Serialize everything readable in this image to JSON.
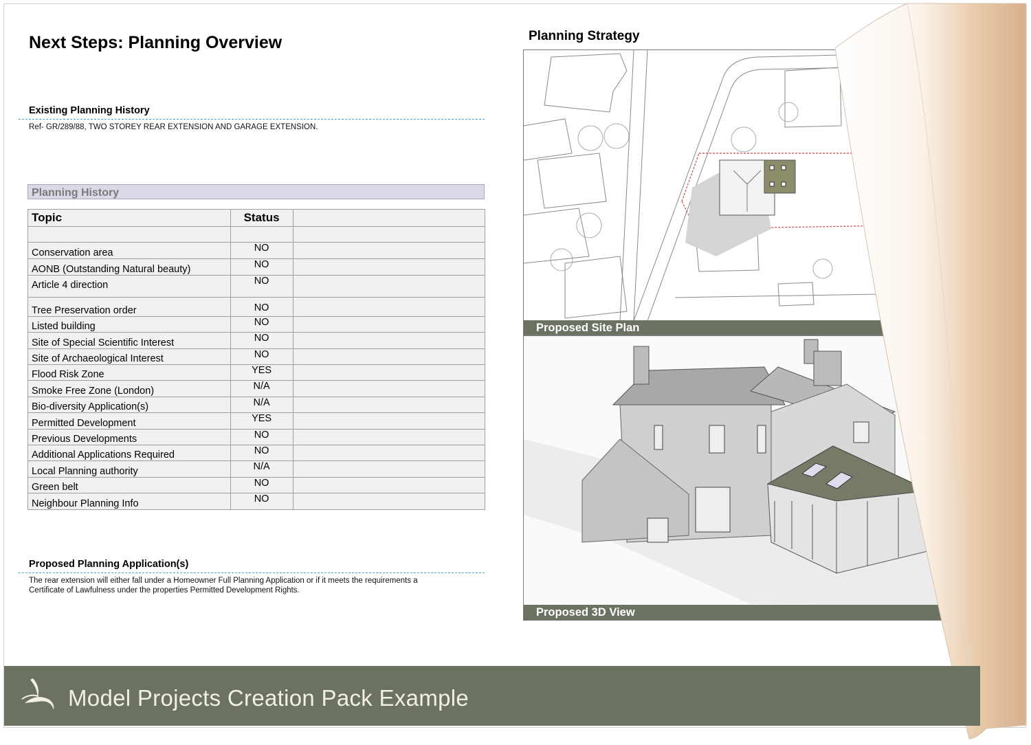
{
  "page": {
    "title": "Next Steps: Planning Overview"
  },
  "existing_history": {
    "heading": "Existing Planning History",
    "text": "Ref- GR/289/88, TWO STOREY REAR EXTENSION AND GARAGE EXTENSION."
  },
  "planning_history": {
    "heading": "Planning History",
    "columns": [
      "Topic",
      "Status"
    ],
    "rows": [
      {
        "topic": "Conservation area",
        "status": "NO"
      },
      {
        "topic": "AONB (Outstanding Natural beauty)",
        "status": "NO"
      },
      {
        "topic": "Article 4 direction",
        "status": "NO"
      },
      {
        "topic": "Tree Preservation order",
        "status": "NO"
      },
      {
        "topic": "Listed building",
        "status": "NO"
      },
      {
        "topic": "Site of Special Scientific Interest",
        "status": "NO"
      },
      {
        "topic": "Site of Archaeological Interest",
        "status": "NO"
      },
      {
        "topic": "Flood Risk Zone",
        "status": "YES"
      },
      {
        "topic": "Smoke Free Zone (London)",
        "status": "N/A"
      },
      {
        "topic": "Bio-diversity Application(s)",
        "status": "N/A"
      },
      {
        "topic": "Permitted Development",
        "status": "YES"
      },
      {
        "topic": "Previous Developments",
        "status": "NO"
      },
      {
        "topic": "Additional Applications Required",
        "status": "NO"
      },
      {
        "topic": "Local Planning authority",
        "status": "N/A"
      },
      {
        "topic": "Green belt",
        "status": "NO"
      },
      {
        "topic": "Neighbour Planning Info",
        "status": "NO"
      }
    ]
  },
  "proposed_applications": {
    "heading": "Proposed Planning Application(s)",
    "line1": "The rear extension will either fall under a Homeowner Full Planning Application or if it meets the requirements a",
    "line2": "Certificate of Lawfulness under the properties Permitted Development Rights."
  },
  "strategy": {
    "heading": "Planning Strategy",
    "site_plan_label": "Proposed Site Plan",
    "view_3d_label": "Proposed 3D View"
  },
  "footer": {
    "text": "Model Projects Creation Pack Example",
    "logo_icon": "swoosh-logo-icon"
  },
  "colors": {
    "accent": "#6b7261",
    "dash": "#4aa3d6",
    "table_bg": "#f1f1f1",
    "header_bar": "#dcd8e6"
  }
}
